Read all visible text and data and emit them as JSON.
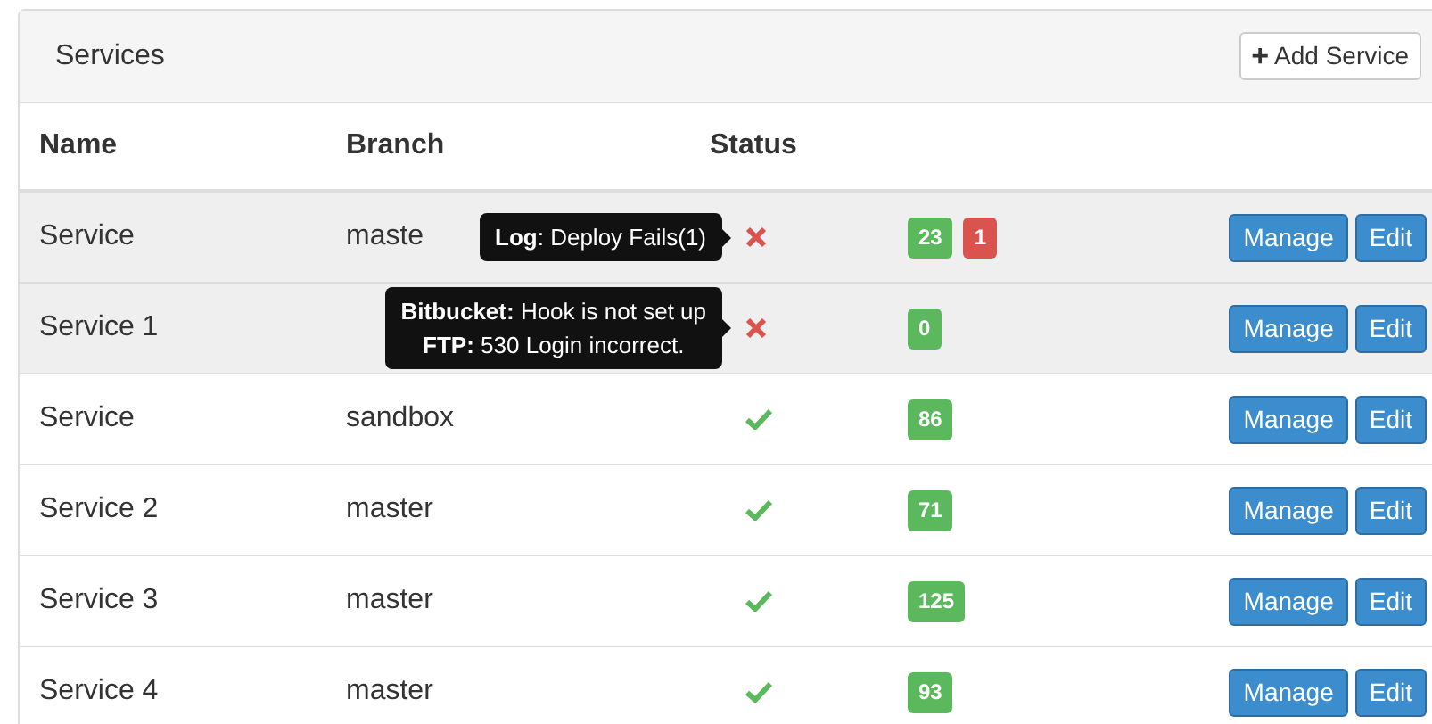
{
  "panel": {
    "title": "Services",
    "add_button": {
      "icon": "+",
      "label": "Add Service"
    }
  },
  "table": {
    "columns": [
      "Name",
      "Branch",
      "Status"
    ],
    "rows": [
      {
        "name": "Service",
        "branch": "maste",
        "shaded": true,
        "status": {
          "kind": "error",
          "tooltip": [
            "**Log**: Deploy Fails(1)"
          ]
        },
        "badges": [
          {
            "text": "23",
            "color": "#5cb85c"
          },
          {
            "text": "1",
            "color": "#d9534f"
          }
        ],
        "buttons": [
          "Manage",
          "Edit"
        ]
      },
      {
        "name": "Service 1",
        "shaded": true,
        "status": {
          "kind": "error",
          "tooltip": [
            "**Bitbucket:** Hook is not set up",
            "**FTP:** 530 Login incorrect."
          ]
        },
        "badges": [
          {
            "text": "0",
            "color": "#5cb85c"
          }
        ],
        "buttons": [
          "Manage",
          "Edit"
        ]
      },
      {
        "name": "Service",
        "branch": "sandbox",
        "shaded": false,
        "status": {
          "kind": "ok"
        },
        "badges": [
          {
            "text": "86",
            "color": "#5cb85c"
          }
        ],
        "buttons": [
          "Manage",
          "Edit"
        ]
      },
      {
        "name": "Service 2",
        "branch": "master",
        "shaded": false,
        "status": {
          "kind": "ok"
        },
        "badges": [
          {
            "text": "71",
            "color": "#5cb85c"
          }
        ],
        "buttons": [
          "Manage",
          "Edit"
        ]
      },
      {
        "name": "Service 3",
        "branch": "master",
        "shaded": false,
        "status": {
          "kind": "ok"
        },
        "badges": [
          {
            "text": "125",
            "color": "#5cb85c"
          }
        ],
        "buttons": [
          "Manage",
          "Edit"
        ]
      },
      {
        "name": "Service 4",
        "branch": "master",
        "shaded": false,
        "status": {
          "kind": "ok"
        },
        "badges": [
          {
            "text": "93",
            "color": "#5cb85c"
          }
        ],
        "buttons": [
          "Manage",
          "Edit"
        ]
      }
    ]
  }
}
